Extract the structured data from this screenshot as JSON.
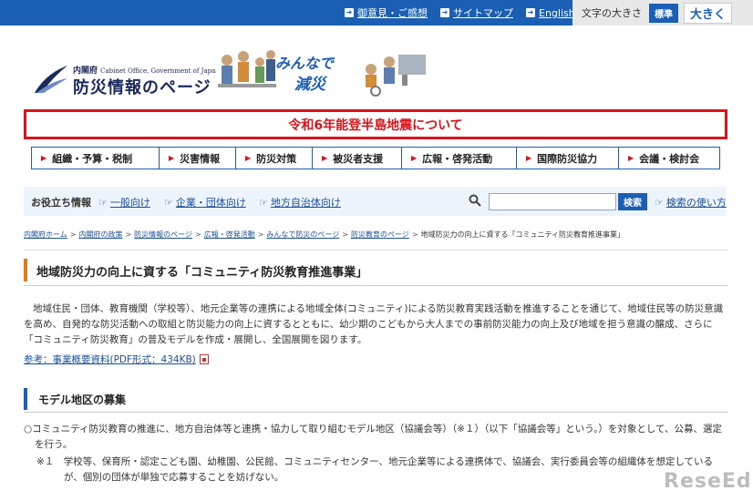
{
  "top_links": [
    "御意見・ご感想",
    "サイトマップ",
    "English"
  ],
  "font_size": {
    "label": "文字の大きさ",
    "standard": "標準",
    "large": "大きく"
  },
  "logo": {
    "small": "内閣府",
    "small_en": "Cabinet Office, Government of Japan",
    "title": "防災情報のページ"
  },
  "banner": {
    "line1": "みんなで",
    "line2": "減災"
  },
  "alert": "令和6年能登半島地震について",
  "gnav": [
    "組織・予算・税制",
    "災害情報",
    "防災対策",
    "被災者支援",
    "広報・啓発活動",
    "国際防災協力",
    "会議・検討会"
  ],
  "helper": {
    "label": "お役立ち情報",
    "links": [
      "一般向け",
      "企業・団体向け",
      "地方自治体向け"
    ],
    "search_button": "検索",
    "search_help": "検索の使い方"
  },
  "breadcrumb": [
    "内閣府ホーム",
    "内閣府の政策",
    "防災情報のページ",
    "広報・啓発活動",
    "みんなで防災のページ",
    "防災教育のページ"
  ],
  "breadcrumb_current": "地域防災力の向上に資する「コミュニティ防災教育推進事業」",
  "page_title": "地域防災力の向上に資する「コミュニティ防災教育推進事業」",
  "body": "地域住民・団体、教育機関（学校等）、地元企業等の連携による地域全体(コミュニティ)による防災教育実践活動を推進することを通じて、地域住民等の防災意識を高め、自発的な防災活動への取組と防災能力の向上に資するとともに、幼少期のこどもから大人までの事前防災能力の向上及び地域を担う意識の醸成、さらに「コミュニティ防災教育」の普及モデルを作成・展開し、全国展開を図ります。",
  "ref_link": "参考：事業概要資料(PDF形式：434KB)",
  "section": {
    "title": "モデル地区の募集",
    "p1": "○コミュニティ防災教育の推進に、地方自治体等と連携・協力して取り組むモデル地区（協議会等）（※１）（以下「協議会等」という。）を対象として、公募、選定を行う。",
    "note": "※１　学校等、保育所・認定こども園、幼稚園、公民館、コミュニティセンター、地元企業等による連携体で、協議会、実行委員会等の組織体を想定しているが、個別の団体が単独で応募することを妨げない。"
  },
  "watermark": "ReseEd",
  "colors": {
    "brand": "#1a5fb4",
    "alert": "#d9141a",
    "accent": "#e07a1e"
  }
}
